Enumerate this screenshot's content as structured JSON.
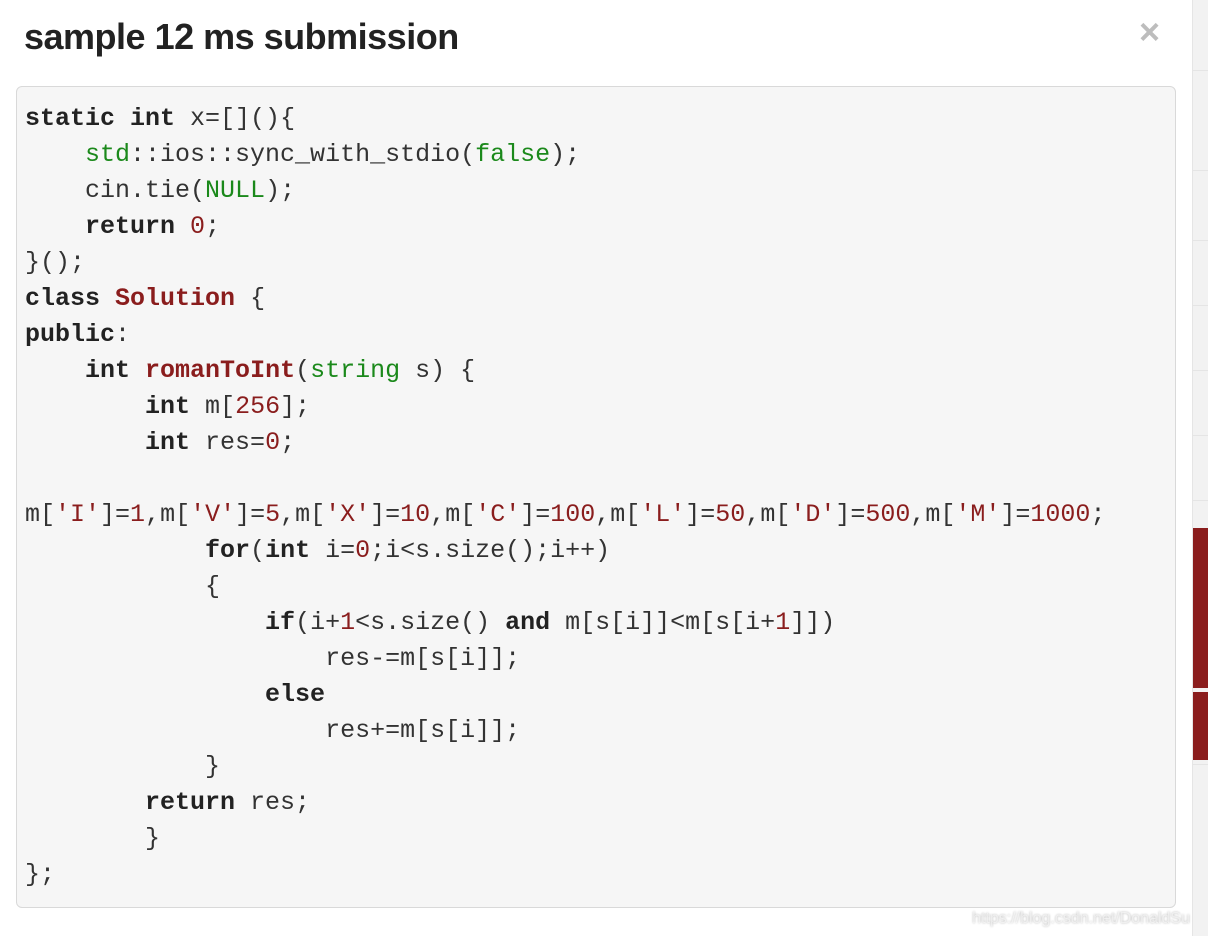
{
  "modal": {
    "title": "sample 12 ms submission",
    "close_glyph": "×"
  },
  "watermark": "https://blog.csdn.net/DonaldSu",
  "code": {
    "tokens": [
      {
        "t": "static",
        "c": "kw"
      },
      {
        "t": " "
      },
      {
        "t": "int",
        "c": "kw"
      },
      {
        "t": " x=[](){\n"
      },
      {
        "t": "    "
      },
      {
        "t": "std",
        "c": "ty"
      },
      {
        "t": "::ios::sync_with_stdio("
      },
      {
        "t": "false",
        "c": "ty"
      },
      {
        "t": ");\n"
      },
      {
        "t": "    cin.tie("
      },
      {
        "t": "NULL",
        "c": "ty"
      },
      {
        "t": ");\n"
      },
      {
        "t": "    "
      },
      {
        "t": "return",
        "c": "kw"
      },
      {
        "t": " "
      },
      {
        "t": "0",
        "c": "num"
      },
      {
        "t": ";\n"
      },
      {
        "t": "}();\n"
      },
      {
        "t": "class",
        "c": "kw"
      },
      {
        "t": " "
      },
      {
        "t": "Solution",
        "c": "fn"
      },
      {
        "t": " {\n"
      },
      {
        "t": "public",
        "c": "kw"
      },
      {
        "t": ":\n"
      },
      {
        "t": "    "
      },
      {
        "t": "int",
        "c": "kw"
      },
      {
        "t": " "
      },
      {
        "t": "romanToInt",
        "c": "fn"
      },
      {
        "t": "("
      },
      {
        "t": "string",
        "c": "ty"
      },
      {
        "t": " s) {\n"
      },
      {
        "t": "        "
      },
      {
        "t": "int",
        "c": "kw"
      },
      {
        "t": " m["
      },
      {
        "t": "256",
        "c": "num"
      },
      {
        "t": "];\n"
      },
      {
        "t": "        "
      },
      {
        "t": "int",
        "c": "kw"
      },
      {
        "t": " res="
      },
      {
        "t": "0",
        "c": "num"
      },
      {
        "t": ";\n"
      },
      {
        "t": "        m["
      },
      {
        "t": "'I'",
        "c": "str"
      },
      {
        "t": "]="
      },
      {
        "t": "1",
        "c": "num"
      },
      {
        "t": ",m["
      },
      {
        "t": "'V'",
        "c": "str"
      },
      {
        "t": "]="
      },
      {
        "t": "5",
        "c": "num"
      },
      {
        "t": ",m["
      },
      {
        "t": "'X'",
        "c": "str"
      },
      {
        "t": "]="
      },
      {
        "t": "10",
        "c": "num"
      },
      {
        "t": ",m["
      },
      {
        "t": "'C'",
        "c": "str"
      },
      {
        "t": "]="
      },
      {
        "t": "100",
        "c": "num"
      },
      {
        "t": ",m["
      },
      {
        "t": "'L'",
        "c": "str"
      },
      {
        "t": "]="
      },
      {
        "t": "50",
        "c": "num"
      },
      {
        "t": ",m["
      },
      {
        "t": "'D'",
        "c": "str"
      },
      {
        "t": "]="
      },
      {
        "t": "500",
        "c": "num"
      },
      {
        "t": ",m["
      },
      {
        "t": "'M'",
        "c": "str"
      },
      {
        "t": "]="
      },
      {
        "t": "1000",
        "c": "num"
      },
      {
        "t": ";\n"
      },
      {
        "t": "            "
      },
      {
        "t": "for",
        "c": "kw"
      },
      {
        "t": "("
      },
      {
        "t": "int",
        "c": "kw"
      },
      {
        "t": " i="
      },
      {
        "t": "0",
        "c": "num"
      },
      {
        "t": ";i<s.size();i++)\n"
      },
      {
        "t": "            {\n"
      },
      {
        "t": "                "
      },
      {
        "t": "if",
        "c": "kw"
      },
      {
        "t": "(i+"
      },
      {
        "t": "1",
        "c": "num"
      },
      {
        "t": "<s.size() "
      },
      {
        "t": "and",
        "c": "kw"
      },
      {
        "t": " m[s[i]]<m[s[i+"
      },
      {
        "t": "1",
        "c": "num"
      },
      {
        "t": "]])\n"
      },
      {
        "t": "                    res-=m[s[i]];\n"
      },
      {
        "t": "                "
      },
      {
        "t": "else",
        "c": "kw"
      },
      {
        "t": "\n"
      },
      {
        "t": "                    res+=m[s[i]];\n"
      },
      {
        "t": "            }\n"
      },
      {
        "t": "        "
      },
      {
        "t": "return",
        "c": "kw"
      },
      {
        "t": " res;\n"
      },
      {
        "t": "        }\n"
      },
      {
        "t": "};"
      }
    ]
  }
}
